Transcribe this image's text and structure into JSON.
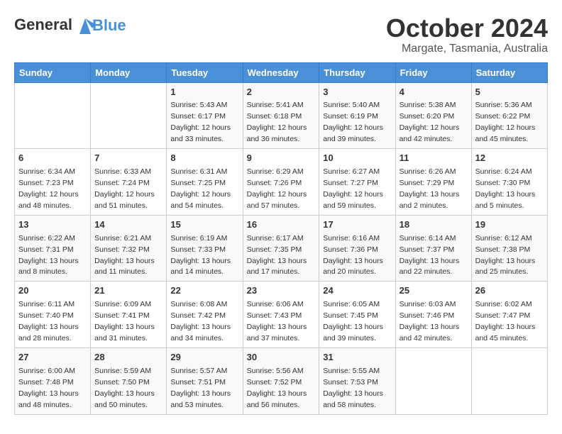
{
  "header": {
    "logo_line1": "General",
    "logo_line2": "Blue",
    "title": "October 2024",
    "subtitle": "Margate, Tasmania, Australia"
  },
  "days_of_week": [
    "Sunday",
    "Monday",
    "Tuesday",
    "Wednesday",
    "Thursday",
    "Friday",
    "Saturday"
  ],
  "weeks": [
    [
      {
        "day": "",
        "info": ""
      },
      {
        "day": "",
        "info": ""
      },
      {
        "day": "1",
        "info": "Sunrise: 5:43 AM\nSunset: 6:17 PM\nDaylight: 12 hours and 33 minutes."
      },
      {
        "day": "2",
        "info": "Sunrise: 5:41 AM\nSunset: 6:18 PM\nDaylight: 12 hours and 36 minutes."
      },
      {
        "day": "3",
        "info": "Sunrise: 5:40 AM\nSunset: 6:19 PM\nDaylight: 12 hours and 39 minutes."
      },
      {
        "day": "4",
        "info": "Sunrise: 5:38 AM\nSunset: 6:20 PM\nDaylight: 12 hours and 42 minutes."
      },
      {
        "day": "5",
        "info": "Sunrise: 5:36 AM\nSunset: 6:22 PM\nDaylight: 12 hours and 45 minutes."
      }
    ],
    [
      {
        "day": "6",
        "info": "Sunrise: 6:34 AM\nSunset: 7:23 PM\nDaylight: 12 hours and 48 minutes."
      },
      {
        "day": "7",
        "info": "Sunrise: 6:33 AM\nSunset: 7:24 PM\nDaylight: 12 hours and 51 minutes."
      },
      {
        "day": "8",
        "info": "Sunrise: 6:31 AM\nSunset: 7:25 PM\nDaylight: 12 hours and 54 minutes."
      },
      {
        "day": "9",
        "info": "Sunrise: 6:29 AM\nSunset: 7:26 PM\nDaylight: 12 hours and 57 minutes."
      },
      {
        "day": "10",
        "info": "Sunrise: 6:27 AM\nSunset: 7:27 PM\nDaylight: 12 hours and 59 minutes."
      },
      {
        "day": "11",
        "info": "Sunrise: 6:26 AM\nSunset: 7:29 PM\nDaylight: 13 hours and 2 minutes."
      },
      {
        "day": "12",
        "info": "Sunrise: 6:24 AM\nSunset: 7:30 PM\nDaylight: 13 hours and 5 minutes."
      }
    ],
    [
      {
        "day": "13",
        "info": "Sunrise: 6:22 AM\nSunset: 7:31 PM\nDaylight: 13 hours and 8 minutes."
      },
      {
        "day": "14",
        "info": "Sunrise: 6:21 AM\nSunset: 7:32 PM\nDaylight: 13 hours and 11 minutes."
      },
      {
        "day": "15",
        "info": "Sunrise: 6:19 AM\nSunset: 7:33 PM\nDaylight: 13 hours and 14 minutes."
      },
      {
        "day": "16",
        "info": "Sunrise: 6:17 AM\nSunset: 7:35 PM\nDaylight: 13 hours and 17 minutes."
      },
      {
        "day": "17",
        "info": "Sunrise: 6:16 AM\nSunset: 7:36 PM\nDaylight: 13 hours and 20 minutes."
      },
      {
        "day": "18",
        "info": "Sunrise: 6:14 AM\nSunset: 7:37 PM\nDaylight: 13 hours and 22 minutes."
      },
      {
        "day": "19",
        "info": "Sunrise: 6:12 AM\nSunset: 7:38 PM\nDaylight: 13 hours and 25 minutes."
      }
    ],
    [
      {
        "day": "20",
        "info": "Sunrise: 6:11 AM\nSunset: 7:40 PM\nDaylight: 13 hours and 28 minutes."
      },
      {
        "day": "21",
        "info": "Sunrise: 6:09 AM\nSunset: 7:41 PM\nDaylight: 13 hours and 31 minutes."
      },
      {
        "day": "22",
        "info": "Sunrise: 6:08 AM\nSunset: 7:42 PM\nDaylight: 13 hours and 34 minutes."
      },
      {
        "day": "23",
        "info": "Sunrise: 6:06 AM\nSunset: 7:43 PM\nDaylight: 13 hours and 37 minutes."
      },
      {
        "day": "24",
        "info": "Sunrise: 6:05 AM\nSunset: 7:45 PM\nDaylight: 13 hours and 39 minutes."
      },
      {
        "day": "25",
        "info": "Sunrise: 6:03 AM\nSunset: 7:46 PM\nDaylight: 13 hours and 42 minutes."
      },
      {
        "day": "26",
        "info": "Sunrise: 6:02 AM\nSunset: 7:47 PM\nDaylight: 13 hours and 45 minutes."
      }
    ],
    [
      {
        "day": "27",
        "info": "Sunrise: 6:00 AM\nSunset: 7:48 PM\nDaylight: 13 hours and 48 minutes."
      },
      {
        "day": "28",
        "info": "Sunrise: 5:59 AM\nSunset: 7:50 PM\nDaylight: 13 hours and 50 minutes."
      },
      {
        "day": "29",
        "info": "Sunrise: 5:57 AM\nSunset: 7:51 PM\nDaylight: 13 hours and 53 minutes."
      },
      {
        "day": "30",
        "info": "Sunrise: 5:56 AM\nSunset: 7:52 PM\nDaylight: 13 hours and 56 minutes."
      },
      {
        "day": "31",
        "info": "Sunrise: 5:55 AM\nSunset: 7:53 PM\nDaylight: 13 hours and 58 minutes."
      },
      {
        "day": "",
        "info": ""
      },
      {
        "day": "",
        "info": ""
      }
    ]
  ]
}
